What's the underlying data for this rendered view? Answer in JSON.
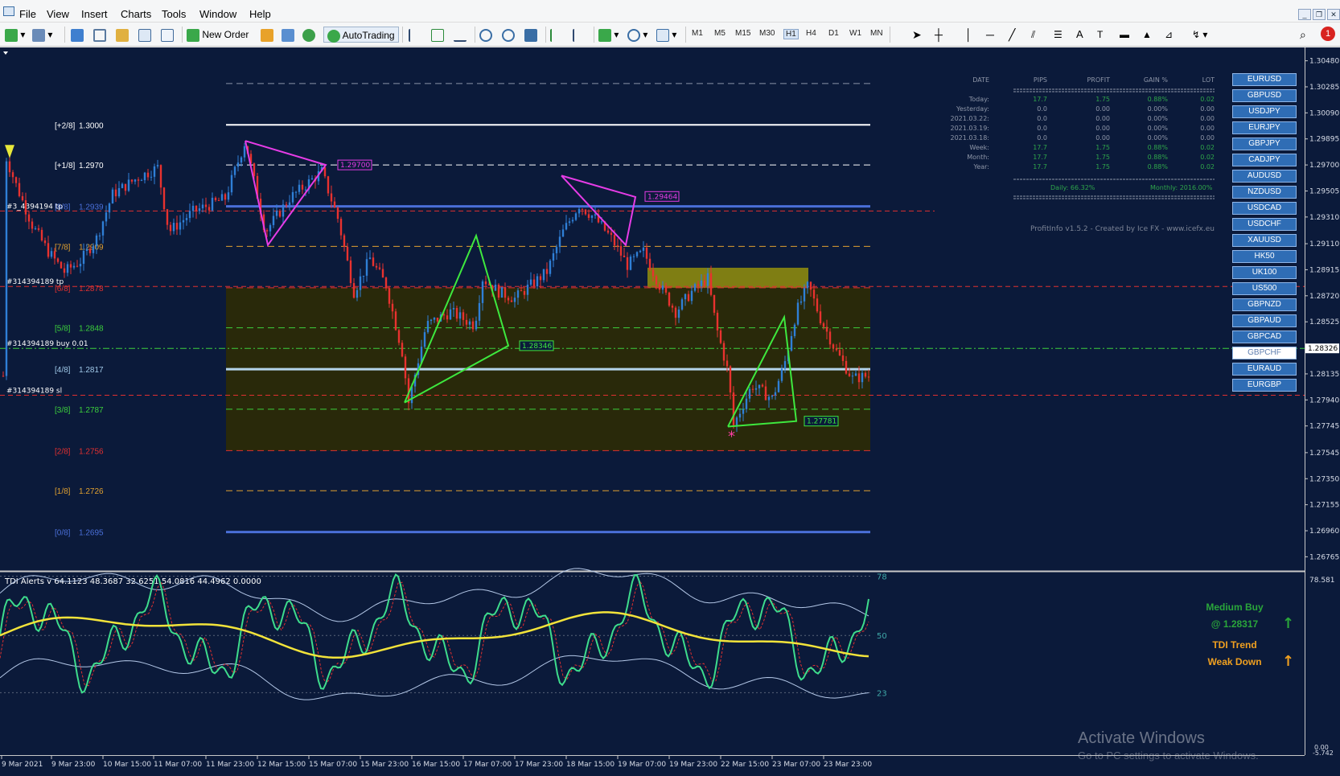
{
  "menu": {
    "items": [
      "File",
      "View",
      "Insert",
      "Charts",
      "Tools",
      "Window",
      "Help"
    ]
  },
  "toolbar": {
    "new_order": "New Order",
    "auto_trading": "AutoTrading",
    "timeframes": [
      "M1",
      "M5",
      "M15",
      "M30",
      "H1",
      "H4",
      "D1",
      "W1",
      "MN"
    ],
    "active_timeframe": "H1",
    "alert_count": "1"
  },
  "chart": {
    "price_axis": [
      "1.30480",
      "1.30285",
      "1.30090",
      "1.29895",
      "1.29700",
      "1.29505",
      "1.29310",
      "1.29110",
      "1.28915",
      "1.28720",
      "1.28525",
      "1.28326",
      "1.28135",
      "1.27940",
      "1.27745",
      "1.27545",
      "1.27350",
      "1.27155",
      "1.26960",
      "1.26765"
    ],
    "current_price": "1.28326",
    "time_axis": [
      "9 Mar 2021",
      "9 Mar 23:00",
      "10 Mar 15:00",
      "11 Mar 07:00",
      "11 Mar 23:00",
      "12 Mar 15:00",
      "15 Mar 07:00",
      "15 Mar 23:00",
      "16 Mar 15:00",
      "17 Mar 07:00",
      "17 Mar 23:00",
      "18 Mar 15:00",
      "19 Mar 07:00",
      "19 Mar 23:00",
      "22 Mar 15:00",
      "23 Mar 07:00",
      "23 Mar 23:00"
    ],
    "murrey_levels": [
      {
        "label": "[+2/8]",
        "price": "1.3000",
        "color": "#ffffff"
      },
      {
        "label": "[+1/8]",
        "price": "1.2970",
        "color": "#ffffff"
      },
      {
        "label": "[8/8]",
        "price": "1.2939",
        "color": "#4a6fd8"
      },
      {
        "label": "[7/8]",
        "price": "1.2909",
        "color": "#e0a030"
      },
      {
        "label": "[6/8]",
        "price": "1.2878",
        "color": "#e03030"
      },
      {
        "label": "[5/8]",
        "price": "1.2848",
        "color": "#3ccf3c"
      },
      {
        "label": "[4/8]",
        "price": "1.2817",
        "color": "#9fc8e8"
      },
      {
        "label": "[3/8]",
        "price": "1.2787",
        "color": "#3ccf3c"
      },
      {
        "label": "[2/8]",
        "price": "1.2756",
        "color": "#e03030"
      },
      {
        "label": "[1/8]",
        "price": "1.2726",
        "color": "#e0a030"
      },
      {
        "label": "[0/8]",
        "price": "1.2695",
        "color": "#4a6fd8"
      }
    ],
    "order_labels": {
      "tp1": "#3_4394194 tp",
      "tp2": "#314394189 tp",
      "buy": "#314394189 buy 0.01",
      "sl": "#314394189 sl"
    },
    "pattern_labels": {
      "p1": "1.29700",
      "p2": "1.29464",
      "p3": "1.28346",
      "p4": "1.27781"
    }
  },
  "profit_info": {
    "headers": [
      "DATE",
      "PIPS",
      "PROFIT",
      "GAIN %",
      "LOT"
    ],
    "rows": [
      [
        "Today:",
        "17.7",
        "1.75",
        "0.88%",
        "0.02"
      ],
      [
        "Yesterday:",
        "0.0",
        "0.00",
        "0.00%",
        "0.00"
      ],
      [
        "2021.03.22:",
        "0.0",
        "0.00",
        "0.00%",
        "0.00"
      ],
      [
        "2021.03.19:",
        "0.0",
        "0.00",
        "0.00%",
        "0.00"
      ],
      [
        "2021.03.18:",
        "0.0",
        "0.00",
        "0.00%",
        "0.00"
      ],
      [
        "Week:",
        "17.7",
        "1.75",
        "0.88%",
        "0.02"
      ],
      [
        "Month:",
        "17.7",
        "1.75",
        "0.88%",
        "0.02"
      ],
      [
        "Year:",
        "17.7",
        "1.75",
        "0.88%",
        "0.02"
      ]
    ],
    "daily": "Daily: 66.32%",
    "monthly": "Monthly: 2016.00%",
    "credit": "ProfitInfo v1.5.2 - Created by Ice FX - www.icefx.eu"
  },
  "symbols": [
    "EURUSD",
    "GBPUSD",
    "USDJPY",
    "EURJPY",
    "GBPJPY",
    "CADJPY",
    "AUDUSD",
    "NZDUSD",
    "USDCAD",
    "USDCHF",
    "XAUUSD",
    "HK50",
    "UK100",
    "US500",
    "GBPNZD",
    "GBPAUD",
    "GBPCAD",
    "GBPCHF",
    "EURAUD",
    "EURGBP"
  ],
  "active_symbol": "GBPCHF",
  "indicator": {
    "title": "TDI Alerts v 64.1123 48.3687 32.6251 54.0816 44.4962 0.0000",
    "axis": [
      "78.581",
      "0.00",
      "-5.742"
    ],
    "levels": [
      "78",
      "50",
      "23"
    ],
    "signal": "Medium Buy",
    "signal_price": "@ 1.28317",
    "trend_title": "TDI Trend",
    "trend_value": "Weak Down"
  },
  "watermark": {
    "line1": "Activate Windows",
    "line2": "Go to PC settings to activate Windows."
  },
  "colors": {
    "background": "#0b1a3a",
    "bull": "#2f7fd6",
    "bear": "#e8322f",
    "pattern_green": "#3ee83e",
    "pattern_magenta": "#e63ce6",
    "rsi_green": "#3edc8c",
    "signal_yellow": "#f2e33a"
  }
}
